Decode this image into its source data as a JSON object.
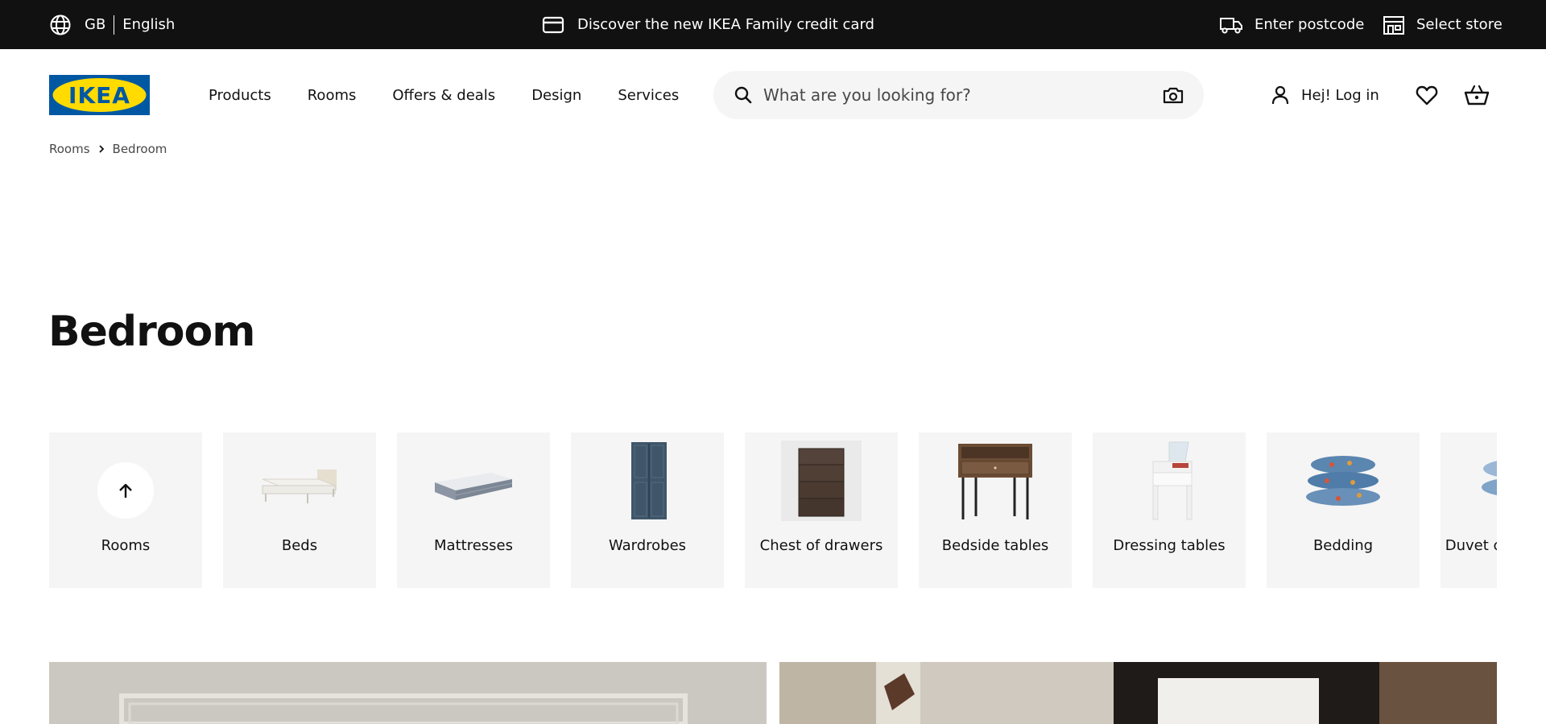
{
  "topbar": {
    "country": "GB",
    "language": "English",
    "promo": "Discover the new IKEA Family credit card",
    "postcode": "Enter postcode",
    "store": "Select store"
  },
  "header": {
    "logo_text": "IKEA",
    "nav": [
      "Products",
      "Rooms",
      "Offers & deals",
      "Design",
      "Services"
    ],
    "search_placeholder": "What are you looking for?",
    "login": "Hej! Log in"
  },
  "breadcrumb": [
    "Rooms",
    "Bedroom"
  ],
  "page": {
    "title": "Bedroom"
  },
  "categories": [
    {
      "label": "Rooms",
      "icon": "arrow-up-icon"
    },
    {
      "label": "Beds",
      "icon": "bed-icon"
    },
    {
      "label": "Mattresses",
      "icon": "mattress-icon"
    },
    {
      "label": "Wardrobes",
      "icon": "wardrobe-icon"
    },
    {
      "label": "Chest of drawers",
      "icon": "drawers-icon"
    },
    {
      "label": "Bedside tables",
      "icon": "bedside-table-icon"
    },
    {
      "label": "Dressing tables",
      "icon": "dressing-table-icon"
    },
    {
      "label": "Bedding",
      "icon": "bedding-icon"
    },
    {
      "label": "Duvet covers & bed",
      "icon": "duvet-icon"
    }
  ],
  "colors": {
    "topbar_bg": "#111111",
    "brand_blue": "#0058a3",
    "brand_yellow": "#ffdb00",
    "card_bg": "#f5f5f5"
  }
}
